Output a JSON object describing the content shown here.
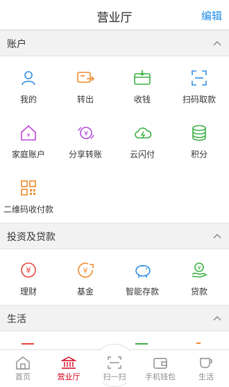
{
  "header": {
    "title": "营业厅",
    "edit_label": "编辑"
  },
  "sections": {
    "account": {
      "label": "账户",
      "items": [
        "我的",
        "转出",
        "收钱",
        "扫码取款",
        "家庭账户",
        "分享转账",
        "云闪付",
        "积分",
        "二维码收付款"
      ]
    },
    "invest": {
      "label": "投资及贷款",
      "items": [
        "理财",
        "基金",
        "智能存款",
        "贷款"
      ]
    },
    "life": {
      "label": "生活"
    }
  },
  "tabs": [
    "首页",
    "营业厅",
    "扫一扫",
    "手机钱包",
    "生活"
  ],
  "active_tab": "营业厅",
  "icon_colors": {
    "my": "#2f8de4",
    "transfer_out": "#f08a2c",
    "receive": "#3cb043",
    "scan_withdraw": "#2f8de4",
    "family": "#c045d8",
    "share": "#b04ad8",
    "cloud_pay": "#3cb043",
    "points": "#3cb043",
    "qr": "#f08a2c",
    "wealth": "#e8453c",
    "fund": "#f08a2c",
    "deposit": "#2f8de4",
    "loan": "#3cb043"
  }
}
